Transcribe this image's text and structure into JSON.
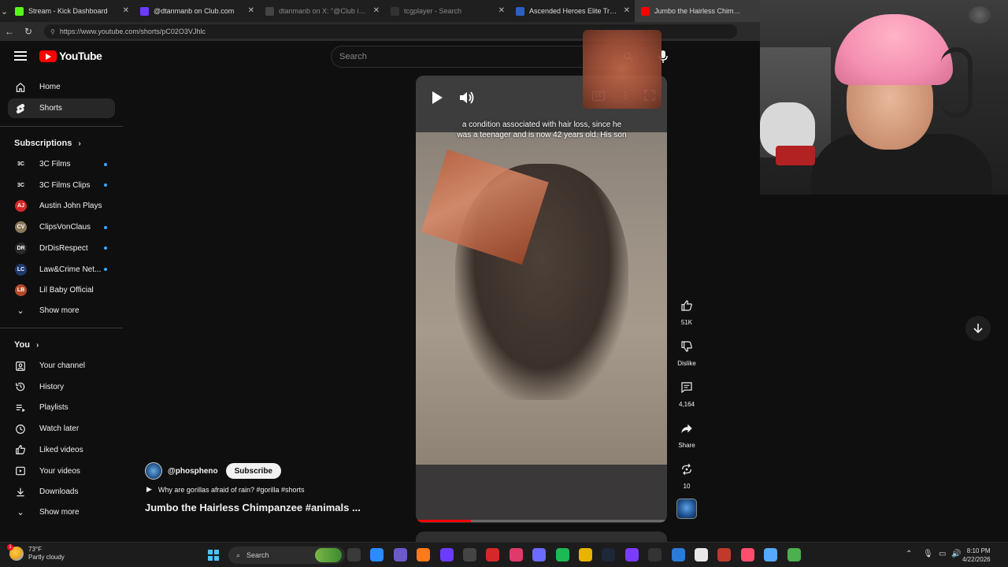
{
  "browser": {
    "tabs": [
      {
        "label": "Stream - Kick Dashboard",
        "favicon_color": "#53fc18",
        "dim": false
      },
      {
        "label": "@dtanmanb on Club.com",
        "favicon_color": "#6b3cff",
        "dim": false
      },
      {
        "label": "dtanmanb on X: \"@Club im curiou",
        "favicon_color": "#444444",
        "dim": true
      },
      {
        "label": "tcgplayer - Search",
        "favicon_color": "#333333",
        "dim": true
      },
      {
        "label": "Ascended Heroes Elite Trainer Box",
        "favicon_color": "#2d5fbf",
        "dim": false
      },
      {
        "label": "Jumbo the Hairless Chimpanzee",
        "favicon_color": "#ff0000",
        "dim": false
      }
    ],
    "url": "https://www.youtube.com/shorts/pC02O3VJhlc"
  },
  "header": {
    "logo_text": "YouTube",
    "search_placeholder": "Search"
  },
  "sidebar": {
    "main": [
      {
        "label": "Home",
        "icon": "home-icon"
      },
      {
        "label": "Shorts",
        "icon": "shorts-icon",
        "active": true
      }
    ],
    "subscriptions_heading": "Subscriptions",
    "subscriptions": [
      {
        "label": "3C Films",
        "avatar_text": "3C",
        "avatar_color": "#111111",
        "new": true
      },
      {
        "label": "3C Films Clips",
        "avatar_text": "3C",
        "avatar_color": "#111111",
        "new": true
      },
      {
        "label": "Austin John Plays",
        "avatar_text": "AJ",
        "avatar_color": "#d62828",
        "new": false
      },
      {
        "label": "ClipsVonClaus",
        "avatar_text": "CV",
        "avatar_color": "#8a7a5a",
        "new": true
      },
      {
        "label": "DrDisRespect",
        "avatar_text": "DR",
        "avatar_color": "#2a2a2a",
        "new": true
      },
      {
        "label": "Law&Crime Net...",
        "avatar_text": "LC",
        "avatar_color": "#1e3a6e",
        "new": true
      },
      {
        "label": "Lil Baby Official",
        "avatar_text": "LB",
        "avatar_color": "#b34a2a",
        "new": false
      }
    ],
    "show_more_1": "Show more",
    "you_heading": "You",
    "you_items": [
      {
        "label": "Your channel",
        "icon": "channel-icon"
      },
      {
        "label": "History",
        "icon": "history-icon"
      },
      {
        "label": "Playlists",
        "icon": "playlists-icon"
      },
      {
        "label": "Watch later",
        "icon": "watch-later-icon"
      },
      {
        "label": "Liked videos",
        "icon": "liked-icon"
      },
      {
        "label": "Your videos",
        "icon": "your-videos-icon"
      },
      {
        "label": "Downloads",
        "icon": "downloads-icon"
      }
    ],
    "show_more_2": "Show more"
  },
  "short": {
    "caption_line1": "a condition associated with hair loss, since he",
    "caption_line2": "was a teenager and is now 42 years old. His son",
    "cc_label": "CC",
    "progress_fraction": 0.22,
    "channel_handle": "@phospheno",
    "subscribe_label": "Subscribe",
    "playlist_text": "Why are gorillas afraid of rain? #gorilla #shorts",
    "title": "Jumbo the Hairless Chimpanzee #animals ..."
  },
  "actions": {
    "likes": "51K",
    "dislike_label": "Dislike",
    "comments": "4,164",
    "share_label": "Share",
    "remix_count": "10"
  },
  "taskbar": {
    "weather_temp": "73°F",
    "weather_desc": "Partly cloudy",
    "weather_badge": "1",
    "search_label": "Search",
    "time": "8:10 PM",
    "date": "4/22/2026"
  }
}
